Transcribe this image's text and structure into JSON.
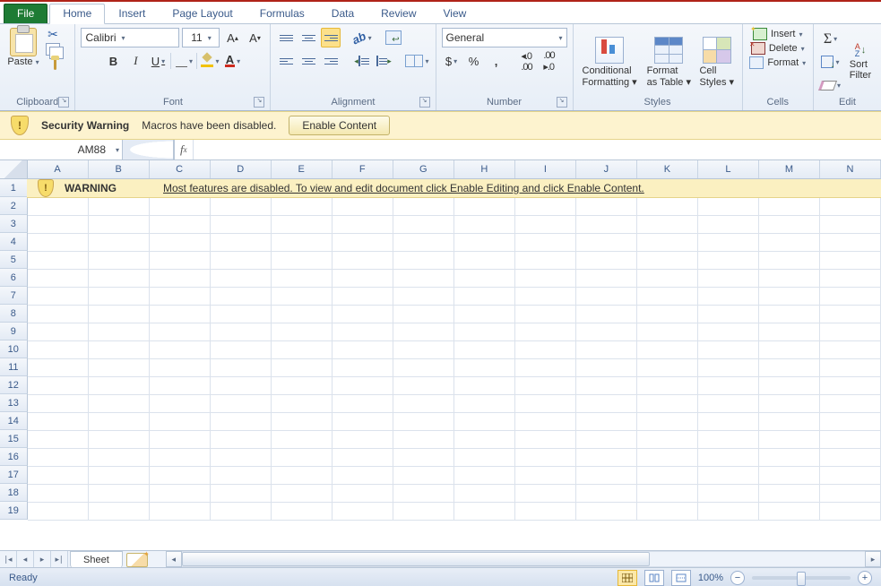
{
  "tabs": {
    "file": "File",
    "home": "Home",
    "insert": "Insert",
    "page_layout": "Page Layout",
    "formulas": "Formulas",
    "data": "Data",
    "review": "Review",
    "view": "View"
  },
  "ribbon": {
    "clipboard": {
      "paste": "Paste",
      "label": "Clipboard"
    },
    "font": {
      "name": "Calibri",
      "size": "11",
      "label": "Font"
    },
    "alignment": {
      "label": "Alignment"
    },
    "number": {
      "format": "General",
      "label": "Number"
    },
    "styles": {
      "cond": "Conditional",
      "cond2": "Formatting",
      "fat": "Format",
      "fat2": "as Table",
      "cell": "Cell",
      "cell2": "Styles",
      "label": "Styles"
    },
    "cells": {
      "insert": "Insert",
      "delete": "Delete",
      "format": "Format",
      "label": "Cells"
    },
    "editing": {
      "sort": "Sort",
      "sort2": "Filter",
      "label": "Edit"
    }
  },
  "security": {
    "title": "Security Warning",
    "msg": "Macros have been disabled.",
    "button": "Enable Content"
  },
  "namebox": "AM88",
  "columns": [
    "A",
    "B",
    "C",
    "D",
    "E",
    "F",
    "G",
    "H",
    "I",
    "J",
    "K",
    "L",
    "M",
    "N"
  ],
  "row_count": 19,
  "warning_row": {
    "title": "WARNING",
    "msg": "Most features are disabled. To view and edit document click Enable Editing and click Enable Content."
  },
  "sheet_tab": "Sheet",
  "status": {
    "ready": "Ready",
    "zoom": "100%"
  }
}
